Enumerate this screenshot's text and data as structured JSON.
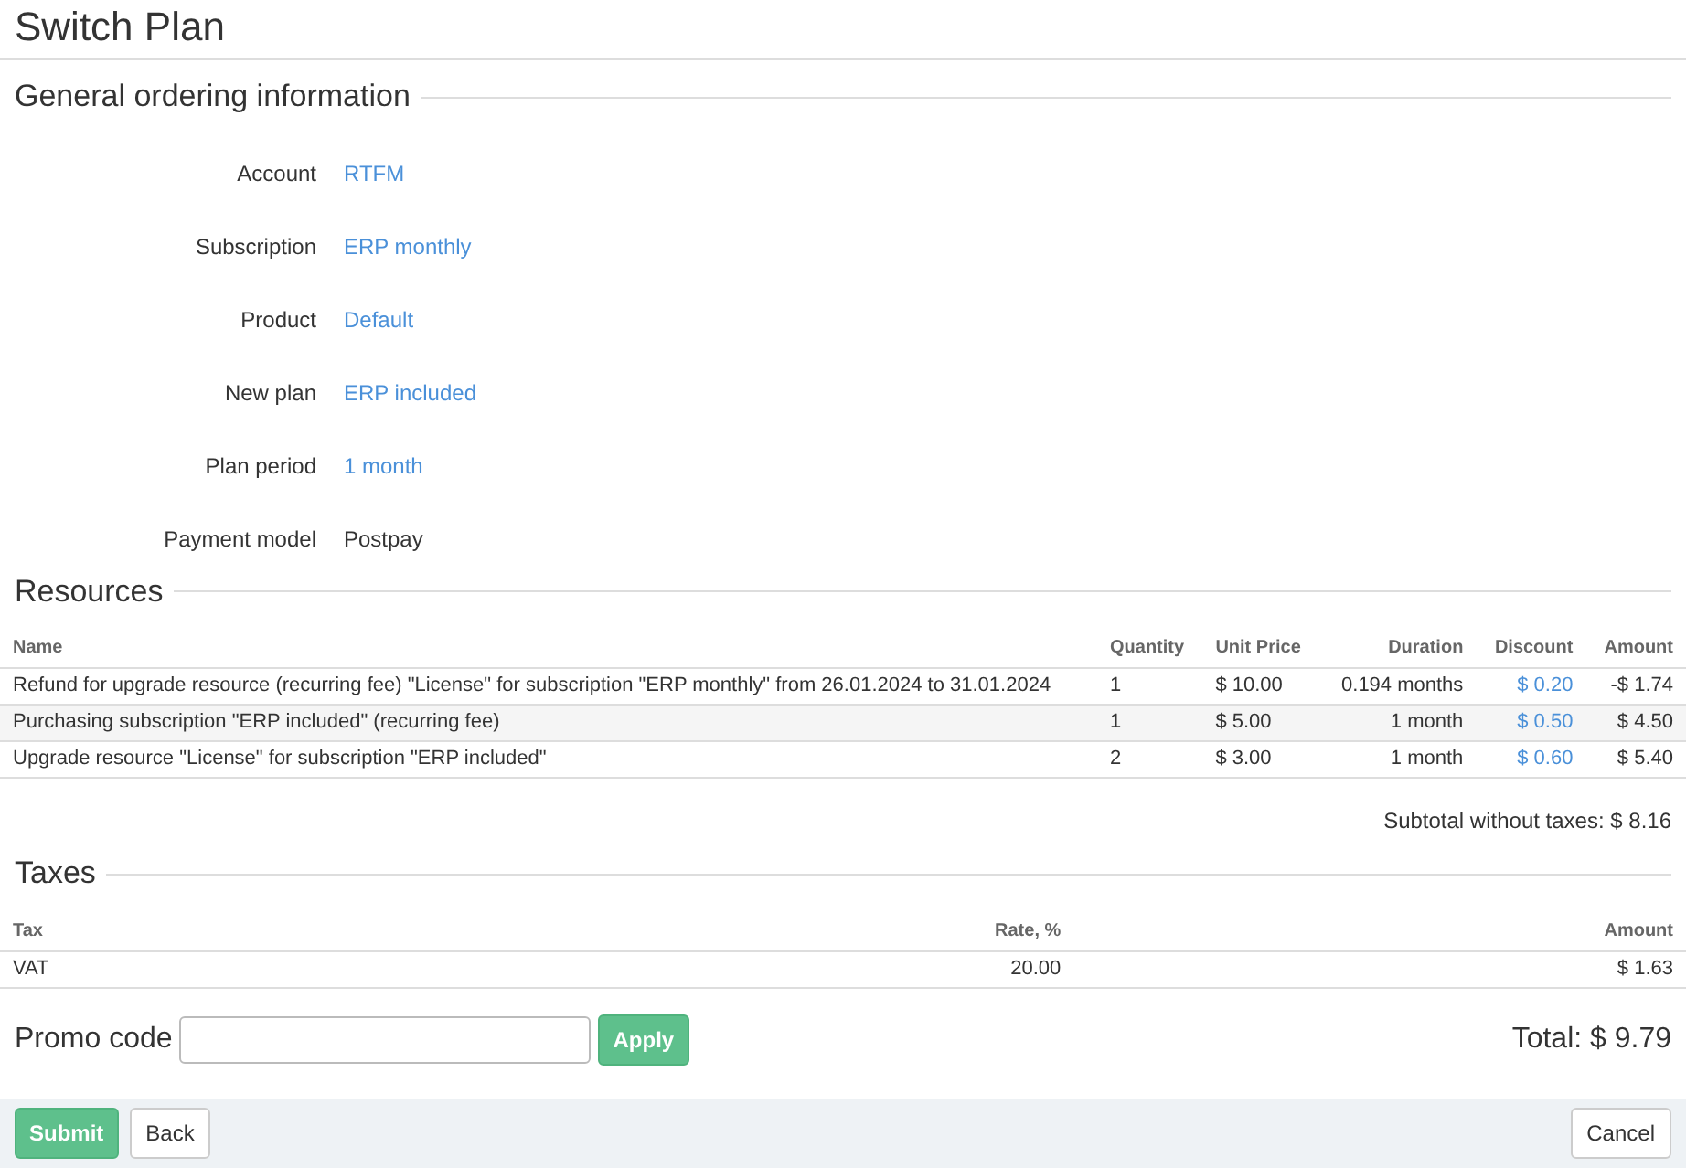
{
  "title": "Switch Plan",
  "general": {
    "heading": "General ordering information",
    "fields": [
      {
        "label": "Account",
        "value": "RTFM",
        "kind": "link"
      },
      {
        "label": "Subscription",
        "value": "ERP monthly",
        "kind": "link"
      },
      {
        "label": "Product",
        "value": "Default",
        "kind": "link"
      },
      {
        "label": "New plan",
        "value": "ERP included",
        "kind": "link"
      },
      {
        "label": "Plan period",
        "value": "1 month",
        "kind": "link"
      },
      {
        "label": "Payment model",
        "value": "Postpay",
        "kind": "text"
      }
    ]
  },
  "resources": {
    "heading": "Resources",
    "columns": [
      "Name",
      "Quantity",
      "Unit Price",
      "Duration",
      "Discount",
      "Amount"
    ],
    "rows": [
      [
        "Refund for upgrade resource (recurring fee) \"License\" for subscription \"ERP monthly\" from 26.01.2024 to 31.01.2024",
        "1",
        "$ 10.00",
        "0.194 months",
        "$ 0.20",
        "-$ 1.74"
      ],
      [
        "Purchasing subscription \"ERP included\" (recurring fee)",
        "1",
        "$ 5.00",
        "1 month",
        "$ 0.50",
        "$ 4.50"
      ],
      [
        "Upgrade resource \"License\" for subscription \"ERP included\"",
        "2",
        "$ 3.00",
        "1 month",
        "$ 0.60",
        "$ 5.40"
      ]
    ],
    "subtotal": "Subtotal without taxes: $ 8.16"
  },
  "taxes": {
    "heading": "Taxes",
    "columns": [
      "Tax",
      "Rate, %",
      "Amount"
    ],
    "rows": [
      [
        "VAT",
        "20.00",
        "$ 1.63"
      ]
    ]
  },
  "promo": {
    "label": "Promo code",
    "button": "Apply"
  },
  "total": "Total: $ 9.79",
  "footer": {
    "buttons": [
      "Submit",
      "Back"
    ],
    "cancel": "Cancel"
  }
}
